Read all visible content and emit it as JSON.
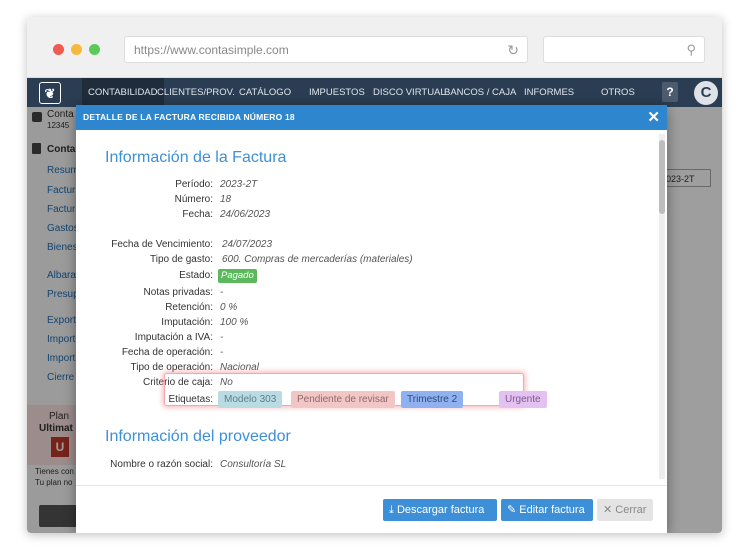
{
  "browser": {
    "url": "https://www.contasimple.com",
    "colors": {
      "close": "#ee5b4f",
      "minimize": "#f5b93d",
      "maximize": "#5cc95b"
    }
  },
  "topnav": {
    "logo": "❦",
    "items": [
      "CONTABILIDAD",
      "CLIENTES/PROV.",
      "CATÁLOGO",
      "IMPUESTOS",
      "DISCO VIRTUAL",
      "BANCOS / CAJA",
      "INFORMES",
      "OTROS"
    ],
    "help_label": "?",
    "avatar_letter": "C"
  },
  "background": {
    "company_name": "Conta",
    "company_id": "12345",
    "section_title": "Conta",
    "side_links": [
      "Resum",
      "Factur",
      "Factur",
      "Gastos",
      "Bienes",
      "Albara",
      "Presup",
      "Export",
      "Import",
      "Import",
      "Cierre"
    ],
    "period_select": "023-2T",
    "column_header": "iones",
    "plan_label": "Plan",
    "plan_name": "Ultimat",
    "plan_badge": "U",
    "plan_note_1": "Tienes con",
    "plan_note_2": "Tu plan no",
    "contract_label": "Contratar otros"
  },
  "modal": {
    "title": "DETALLE DE LA FACTURA RECIBIDA NÚMERO 18",
    "close": "✕",
    "section_invoice": "Información de la Factura",
    "fields": {
      "periodo_label": "Período:",
      "periodo": "2023-2T",
      "numero_label": "Número:",
      "numero": "18",
      "fecha_label": "Fecha:",
      "fecha": "24/06/2023",
      "vencimiento_label": "Fecha de Vencimiento:",
      "vencimiento": "24/07/2023",
      "tipo_gasto_label": "Tipo de gasto:",
      "tipo_gasto": "600. Compras de mercaderías (materiales)",
      "estado_label": "Estado:",
      "estado": "Pagado",
      "notas_label": "Notas privadas:",
      "notas": "-",
      "retencion_label": "Retención:",
      "retencion": "0 %",
      "imputacion_label": "Imputación:",
      "imputacion": "100 %",
      "imputacion_iva_label": "Imputación a IVA:",
      "imputacion_iva": "-",
      "fecha_operacion_label": "Fecha de operación:",
      "fecha_operacion": "-",
      "tipo_operacion_label": "Tipo de operación:",
      "tipo_operacion": "Nacional",
      "criterio_caja_label": "Criterio de caja:",
      "criterio_caja": "No",
      "etiquetas_label": "Etiquetas:"
    },
    "tags": [
      {
        "label": "Modelo 303",
        "bg": "#b9dbe3",
        "fg": "#5f7f88"
      },
      {
        "label": "Pendiente de revisar",
        "bg": "#f3c6c6",
        "fg": "#8c6a6a"
      },
      {
        "label": "Trimestre 2",
        "bg": "#8fb1f0",
        "fg": "#2f4a7a"
      },
      {
        "label": "Urgente",
        "bg": "#e3c1f1",
        "fg": "#7c5a8c"
      }
    ],
    "section_provider": "Información del proveedor",
    "provider": {
      "razon_label": "Nombre o razón social:",
      "razon": "Consultoría SL"
    },
    "buttons": {
      "download": "Descargar factura",
      "edit": "Editar factura",
      "close": "Cerrar"
    }
  }
}
